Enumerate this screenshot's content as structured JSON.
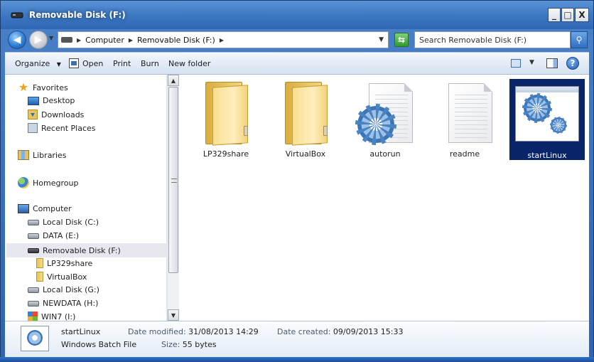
{
  "window": {
    "title": "Removable Disk (F:)",
    "buttons": {
      "minimize": "_",
      "maximize": "□",
      "close": "X"
    }
  },
  "address": {
    "crumbs": [
      "Computer",
      "Removable Disk (F:)"
    ],
    "search_placeholder": "Search Removable Disk (F:)"
  },
  "toolbar": {
    "organize": "Organize",
    "open": "Open",
    "print": "Print",
    "burn": "Burn",
    "new_folder": "New folder",
    "help": "?"
  },
  "nav": {
    "favorites": "Favorites",
    "desktop": "Desktop",
    "downloads": "Downloads",
    "recent_places": "Recent Places",
    "libraries": "Libraries",
    "homegroup": "Homegroup",
    "computer": "Computer",
    "local_c": "Local Disk (C:)",
    "data_e": "DATA (E:)",
    "removable_f": "Removable Disk (F:)",
    "lp329share": "LP329share",
    "virtualbox": "VirtualBox",
    "local_g": "Local Disk (G:)",
    "newdata_h": "NEWDATA (H:)",
    "win7_i": "WIN7 (I:)"
  },
  "files": [
    {
      "name": "LP329share",
      "kind": "folder"
    },
    {
      "name": "VirtualBox",
      "kind": "folder"
    },
    {
      "name": "autorun",
      "kind": "settings"
    },
    {
      "name": "readme",
      "kind": "text"
    },
    {
      "name": "startLinux",
      "kind": "batch"
    }
  ],
  "details": {
    "name": "startLinux",
    "type": "Windows Batch File",
    "date_modified_label": "Date modified:",
    "date_modified": "31/08/2013 14:29",
    "date_created_label": "Date created:",
    "date_created": "09/09/2013 15:33",
    "size_label": "Size:",
    "size": "55 bytes"
  },
  "colors": {
    "selection": "#0a246a",
    "frame": "#3b73bd",
    "nav_selected": "#e5e9ef"
  }
}
